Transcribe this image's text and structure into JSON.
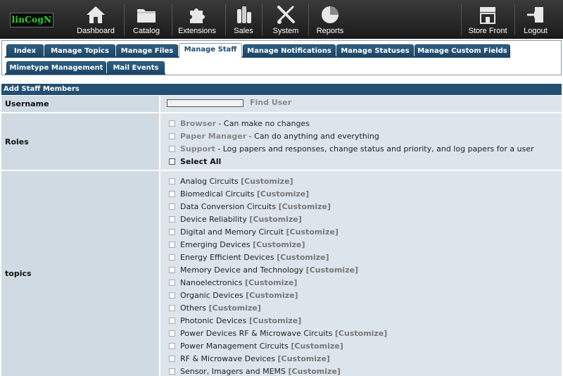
{
  "logo": "linCogN",
  "nav": [
    {
      "label": "Dashboard",
      "icon": "home-icon"
    },
    {
      "label": "Catalog",
      "icon": "folder-icon"
    },
    {
      "label": "Extensions",
      "icon": "puzzle-icon"
    },
    {
      "label": "Sales",
      "icon": "coins-icon"
    },
    {
      "label": "System",
      "icon": "tools-icon"
    },
    {
      "label": "Reports",
      "icon": "pie-chart-icon"
    }
  ],
  "nav_right": [
    {
      "label": "Store Front",
      "icon": "storefront-icon"
    },
    {
      "label": "Logout",
      "icon": "logout-icon"
    }
  ],
  "tabs_row1": [
    "Index",
    "Manage Topics",
    "Manage Files",
    "Manage Staff",
    "Manage Notifications",
    "Manage Statuses",
    "Manage Custom Fields"
  ],
  "tabs_row2": [
    "Mimetype Management",
    "Mail Events"
  ],
  "active_tab": "Manage Staff",
  "form": {
    "header": "Add Staff Members",
    "username_label": "Username",
    "username_value": "",
    "find_user": "Find User",
    "roles_label": "Roles",
    "roles": [
      {
        "name": "Browser",
        "desc": " - Can make no changes"
      },
      {
        "name": "Paper Manager",
        "desc": " - Can do anything and everything"
      },
      {
        "name": "Support",
        "desc": " - Log papers and responses, change status and priority, and log papers for a user"
      }
    ],
    "select_all": "Select All",
    "topics_label": "topics",
    "customize": "[Customize]",
    "topics": [
      "Analog Circuits",
      "Biomedical Circuits",
      "Data Conversion Circuits",
      "Device Reliability",
      "Digital and Memory Circuit",
      "Emerging Devices",
      "Energy Efficient Devices",
      "Memory Device and Technology",
      "Nanoelectronics",
      "Organic Devices",
      "Others",
      "Photonic Devices",
      "Power Devices RF & Microwave Circuits",
      "Power Management Circuits",
      "RF & Microwave Devices",
      "Sensor, Imagers and MEMS"
    ]
  },
  "colors": {
    "topbar": "#2a2a2a",
    "tab": "#234f73",
    "row": "#dde5ec",
    "label_cell": "#cfdae3",
    "logo_text": "#29d629"
  }
}
